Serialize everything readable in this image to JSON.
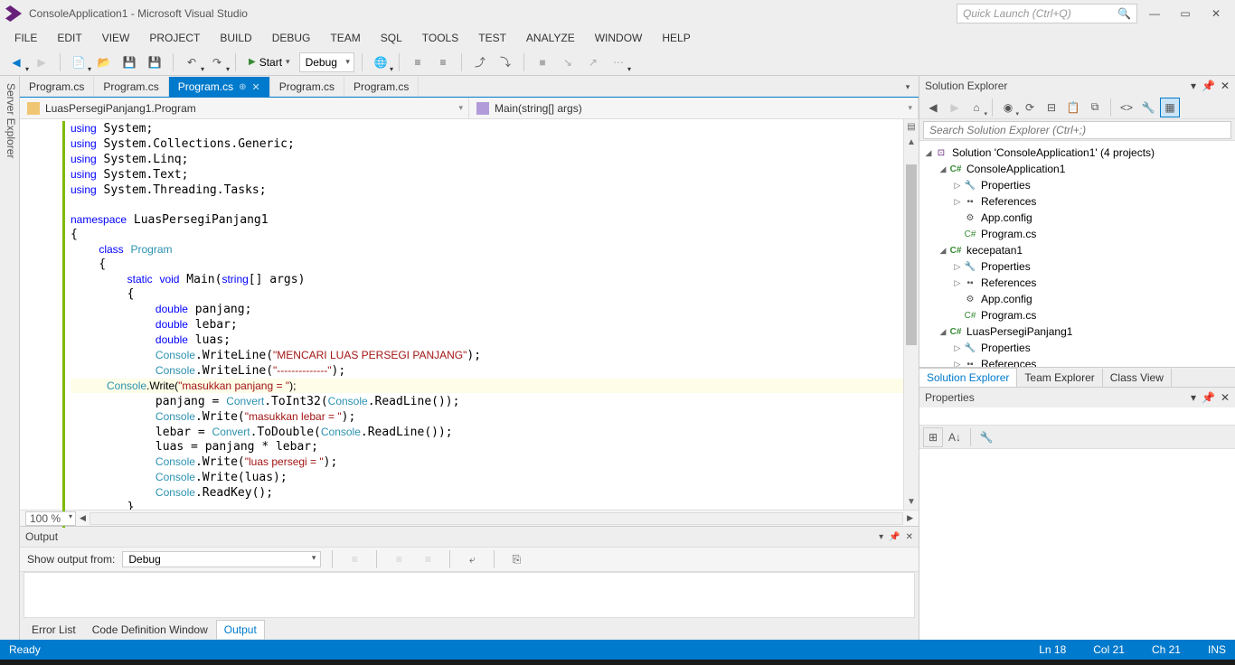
{
  "title": "ConsoleApplication1 - Microsoft Visual Studio",
  "quicklaunch_placeholder": "Quick Launch (Ctrl+Q)",
  "menu": [
    "FILE",
    "EDIT",
    "VIEW",
    "PROJECT",
    "BUILD",
    "DEBUG",
    "TEAM",
    "SQL",
    "TOOLS",
    "TEST",
    "ANALYZE",
    "WINDOW",
    "HELP"
  ],
  "toolbar": {
    "start": "Start",
    "config": "Debug"
  },
  "sidebar_vertical": "Server Explorer",
  "tabs": [
    {
      "label": "Program.cs",
      "active": false
    },
    {
      "label": "Program.cs",
      "active": false
    },
    {
      "label": "Program.cs",
      "active": true
    },
    {
      "label": "Program.cs",
      "active": false
    },
    {
      "label": "Program.cs",
      "active": false
    }
  ],
  "nav": {
    "left": "LuasPersegiPanjang1.Program",
    "right": "Main(string[] args)"
  },
  "zoom": "100 %",
  "code": {
    "usings": [
      "System",
      "System.Collections.Generic",
      "System.Linq",
      "System.Text",
      "System.Threading.Tasks"
    ],
    "namespace": "LuasPersegiPanjang1",
    "class": "Program",
    "method_sig": "static void Main(string[] args)",
    "body": [
      {
        "t": "decl",
        "kw": "double",
        "name": "panjang"
      },
      {
        "t": "decl",
        "kw": "double",
        "name": "lebar"
      },
      {
        "t": "decl",
        "kw": "double",
        "name": "luas"
      },
      {
        "t": "call",
        "obj": "Console",
        "m": "WriteLine",
        "str": "\"MENCARI LUAS PERSEGI PANJANG\""
      },
      {
        "t": "call",
        "obj": "Console",
        "m": "WriteLine",
        "str": "\"--------------\""
      },
      {
        "t": "call",
        "obj": "Console",
        "m": "Write",
        "str": "\"masukkan panjang = \"",
        "hl": true
      },
      {
        "t": "assign",
        "lhs": "panjang",
        "rhs_obj": "Convert",
        "rhs_m": "ToInt32",
        "inner_obj": "Console",
        "inner_m": "ReadLine"
      },
      {
        "t": "call",
        "obj": "Console",
        "m": "Write",
        "str": "\"masukkan lebar = \""
      },
      {
        "t": "assign",
        "lhs": "lebar",
        "rhs_obj": "Convert",
        "rhs_m": "ToDouble",
        "inner_obj": "Console",
        "inner_m": "ReadLine"
      },
      {
        "t": "raw",
        "txt": "luas = panjang * lebar;"
      },
      {
        "t": "call",
        "obj": "Console",
        "m": "Write",
        "str": "\"luas persegi = \""
      },
      {
        "t": "raw",
        "txt": "Console.Write(luas);",
        "obj": "Console"
      },
      {
        "t": "raw",
        "txt": "Console.ReadKey();",
        "obj": "Console"
      }
    ]
  },
  "output": {
    "title": "Output",
    "show_from_label": "Show output from:",
    "show_from": "Debug"
  },
  "bottom_tabs": [
    "Error List",
    "Code Definition Window",
    "Output"
  ],
  "solution_explorer": {
    "title": "Solution Explorer",
    "search_placeholder": "Search Solution Explorer (Ctrl+;)",
    "root": "Solution 'ConsoleApplication1' (4 projects)",
    "projects": [
      {
        "name": "ConsoleApplication1",
        "expanded": true,
        "items": [
          "Properties",
          "References",
          "App.config",
          "Program.cs"
        ]
      },
      {
        "name": "kecepatan1",
        "expanded": true,
        "items": [
          "Properties",
          "References",
          "App.config",
          "Program.cs"
        ]
      },
      {
        "name": "LuasPersegiPanjang1",
        "expanded": true,
        "items": [
          "Properties",
          "References"
        ]
      }
    ]
  },
  "right_tabs": [
    "Solution Explorer",
    "Team Explorer",
    "Class View"
  ],
  "properties": {
    "title": "Properties"
  },
  "status": {
    "ready": "Ready",
    "ln": "Ln 18",
    "col": "Col 21",
    "ch": "Ch 21",
    "ins": "INS"
  }
}
